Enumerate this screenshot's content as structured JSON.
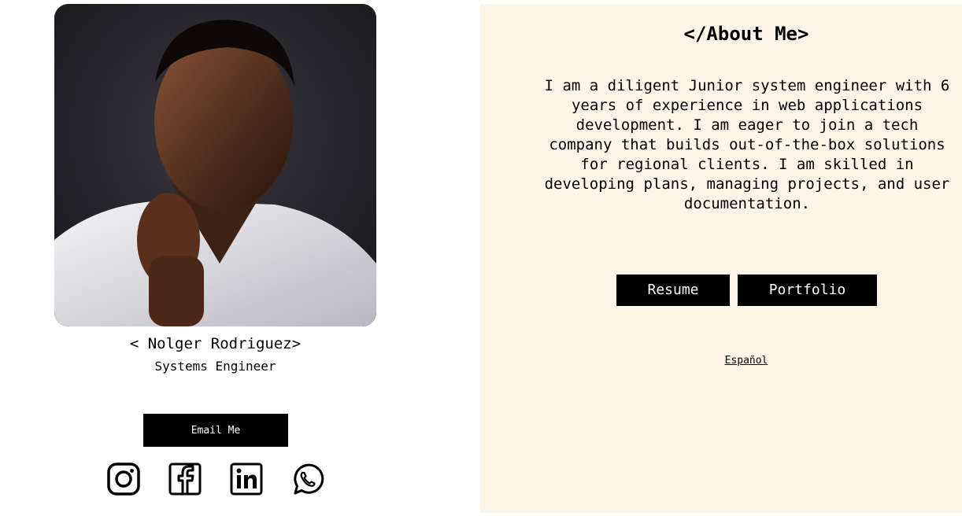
{
  "profile": {
    "name": "< Nolger Rodriguez>",
    "role": "Systems Engineer",
    "email_label": "Email Me",
    "socials": [
      {
        "icon": "instagram-icon"
      },
      {
        "icon": "facebook-icon"
      },
      {
        "icon": "linkedin-icon"
      },
      {
        "icon": "whatsapp-icon"
      }
    ]
  },
  "about": {
    "title": "</About Me>",
    "text": "I am a diligent Junior system engineer with 6 years of experience in web applications development. I am eager to join a tech company that builds out-of-the-box solutions for regional clients. I am skilled in developing plans, managing projects, and user documentation.",
    "resume_label": "Resume",
    "portfolio_label": "Portfolio",
    "language_link": "Español"
  },
  "colors": {
    "panel_bg": "#fdf5e8",
    "button_bg": "#000000",
    "button_text": "#ffffff"
  }
}
